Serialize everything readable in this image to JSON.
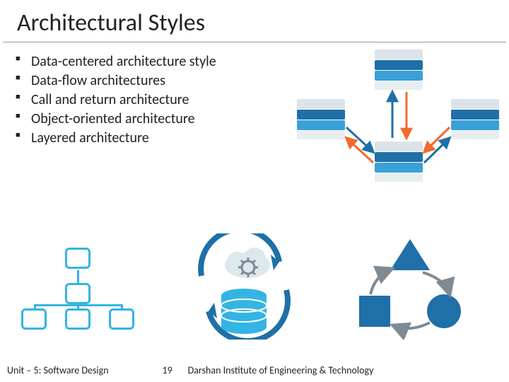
{
  "title": "Architectural Styles",
  "bullets": [
    "Data-centered architecture style",
    "Data-flow architectures",
    "Call and return architecture",
    "Object-oriented architecture",
    "Layered architecture"
  ],
  "footer": {
    "unit": "Unit – 5: Software Design",
    "page": "19",
    "institute": "Darshan Institute of Engineering & Technology"
  },
  "icons": {
    "data_centered": "data-centered-diagram",
    "call_return": "hierarchy-icon",
    "data_flow": "cloud-db-icon",
    "object_oriented": "shapes-cycle-icon"
  },
  "colors": {
    "accent_blue": "#1f6fa8",
    "light_blue": "#34b4e4",
    "orange": "#f06a2a",
    "gray": "#7f8a93"
  }
}
